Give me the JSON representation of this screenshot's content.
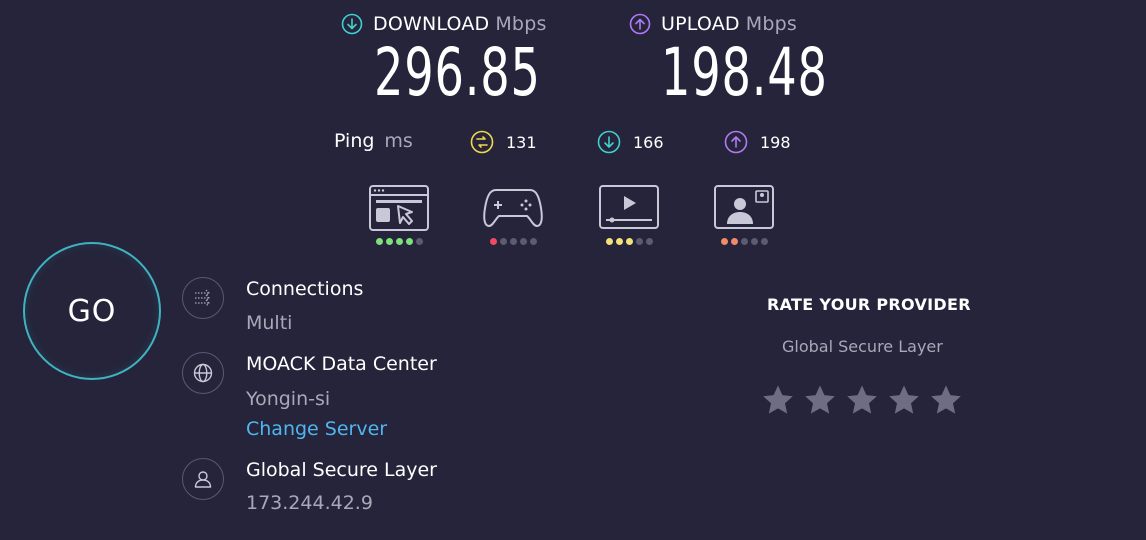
{
  "download": {
    "label": "DOWNLOAD",
    "unit": "Mbps",
    "value": "296.85"
  },
  "upload": {
    "label": "UPLOAD",
    "unit": "Mbps",
    "value": "198.48"
  },
  "ping": {
    "label": "Ping",
    "unit": "ms",
    "idle": "131",
    "download": "166",
    "upload": "198"
  },
  "apps": [
    {
      "name": "web-browsing",
      "rating": 4,
      "total": 5,
      "color": "#7ee07a"
    },
    {
      "name": "gaming",
      "rating": 1,
      "total": 5,
      "color": "#ef4b63"
    },
    {
      "name": "video-streaming",
      "rating": 3,
      "total": 5,
      "color": "#f3e27a"
    },
    {
      "name": "video-chat",
      "rating": 2,
      "total": 5,
      "color": "#f08a6a"
    }
  ],
  "go_label": "GO",
  "connections": {
    "title": "Connections",
    "value": "Multi"
  },
  "server": {
    "title": "MOACK Data Center",
    "location": "Yongin-si",
    "change_label": "Change Server"
  },
  "provider": {
    "title": "Global Secure Layer",
    "ip": "173.244.42.9"
  },
  "rating": {
    "title": "RATE YOUR PROVIDER",
    "provider": "Global Secure Layer",
    "stars": 5
  },
  "colors": {
    "download": "#3fd0d0",
    "upload": "#b17af5",
    "ping_idle": "#f2d94a",
    "link": "#4fb6f0",
    "go_ring": "#3fb3c0"
  }
}
